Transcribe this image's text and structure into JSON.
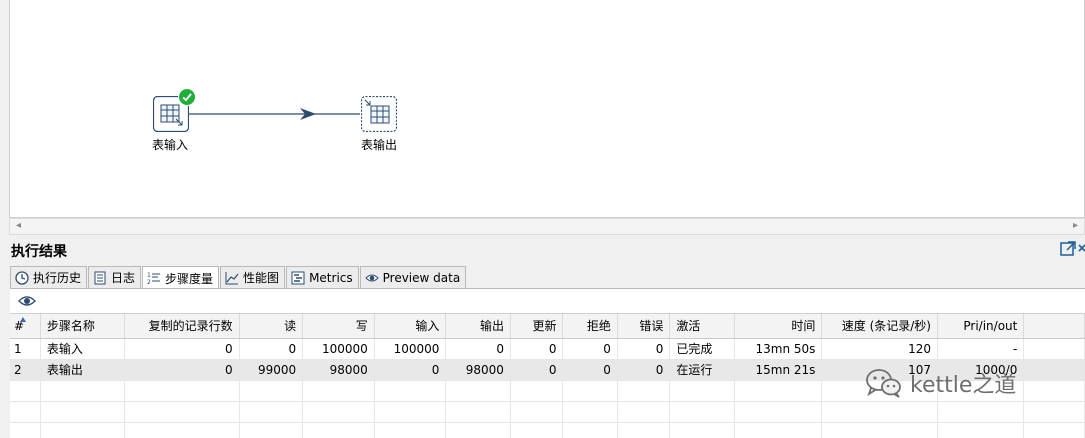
{
  "canvas": {
    "steps": [
      {
        "label": "表输入",
        "status": "done"
      },
      {
        "label": "表输出"
      }
    ]
  },
  "results": {
    "title": "执行结果",
    "tabs": [
      {
        "label": "执行历史",
        "icon": "clock-icon"
      },
      {
        "label": "日志",
        "icon": "log-icon"
      },
      {
        "label": "步骤度量",
        "icon": "step-metrics-icon",
        "active": true
      },
      {
        "label": "性能图",
        "icon": "chart-icon"
      },
      {
        "label": "Metrics",
        "icon": "metrics-icon"
      },
      {
        "label": "Preview data",
        "icon": "eye-icon"
      }
    ],
    "columns": [
      "#",
      "步骤名称",
      "复制的记录行数",
      "读",
      "写",
      "输入",
      "输出",
      "更新",
      "拒绝",
      "错误",
      "激活",
      "时间",
      "速度 (条记录/秒)",
      "Pri/in/out"
    ],
    "rows": [
      [
        "1",
        "表输入",
        "0",
        "0",
        "100000",
        "100000",
        "0",
        "0",
        "0",
        "0",
        "已完成",
        "13mn 50s",
        "120",
        "-"
      ],
      [
        "2",
        "表输出",
        "0",
        "99000",
        "98000",
        "0",
        "98000",
        "0",
        "0",
        "0",
        "在运行",
        "15mn 21s",
        "107",
        "1000/0"
      ]
    ]
  },
  "watermark": {
    "text": "kettle之道",
    "icon": "wechat-icon"
  }
}
